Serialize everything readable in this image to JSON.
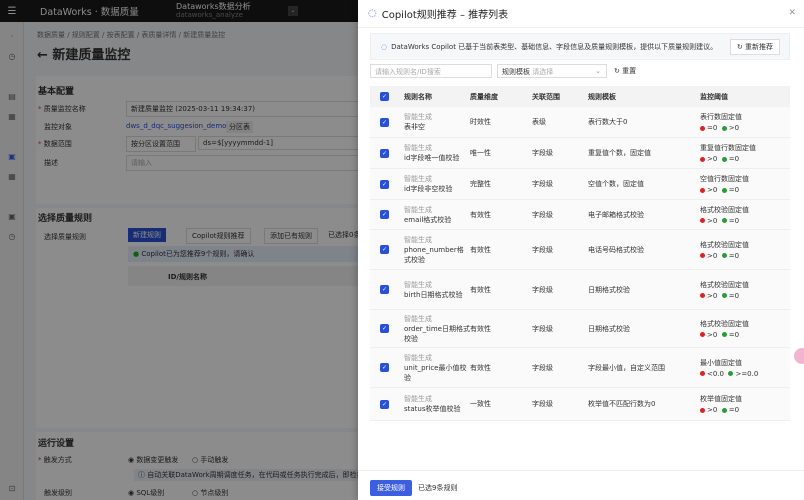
{
  "topbar": {
    "brand": "DataWorks · 数据质量",
    "workspace": "Dataworks数据分析",
    "workspace_id": "dataworks_analyze"
  },
  "page": {
    "breadcrumb": "数据质量 / 规则配置 / 按表配置 / 表质量详情 / 新建质量监控",
    "title": "新建质量监控",
    "basic": {
      "heading": "基本配置",
      "name_label": "质量监控名称",
      "name_value": "新建质量监控 (2025-03-11 19:34:37)",
      "object_label": "监控对象",
      "object_value": "dws_d_dqc_suggesion_demo",
      "object_tag": "分区表",
      "range_label": "数据范围",
      "range_select": "按分区设置范围",
      "range_value": "ds=$[yyyymmdd-1]",
      "desc_label": "描述",
      "desc_placeholder": "请输入"
    },
    "rules": {
      "heading": "选择质量规则",
      "label": "选择质量规则",
      "new_btn": "新建规则",
      "copilot_btn": "Copilot规则推荐",
      "add_btn": "添加已有规则",
      "selected": "已选择0条",
      "notice": "Copilot已为您推荐9个规则，请确认",
      "col": "ID/规则名称"
    },
    "run": {
      "heading": "运行设置",
      "trigger_label": "触发方式",
      "opt1": "数据变更触发",
      "opt2": "手动触发",
      "tip": "自动关联DataWork周期调度任务，在代码或任务执行完成后，即检指定",
      "level_label": "触发级别",
      "lvl1": "SQL级别",
      "lvl2": "节点级别"
    }
  },
  "panel": {
    "title": "Copilot规则推荐 – 推荐列表",
    "info": "DataWorks Copilot 已基于当前表类型、基础信息、字段信息及质量规则模板，提供以下质量规则建议。",
    "refresh": "重新推荐",
    "search_placeholder": "请输入规则名/ID搜索",
    "template_label": "规则模板",
    "template_placeholder": "请选择",
    "reset": "重置",
    "columns": [
      "规则名称",
      "质量维度",
      "关联范围",
      "规则模板",
      "监控阈值"
    ],
    "gen_label": "智能生成",
    "rows": [
      {
        "name": "表非空",
        "dim": "时效性",
        "scope": "表级",
        "tpl": "表行数大于0",
        "th": "表行数固定值",
        "red": "=0",
        "green": ">0"
      },
      {
        "name": "id字段唯一值校验",
        "dim": "唯一性",
        "scope": "字段级",
        "tpl": "重复值个数，固定值",
        "th": "重复值行数固定值",
        "red": ">0",
        "green": "=0"
      },
      {
        "name": "id字段非空校验",
        "dim": "完整性",
        "scope": "字段级",
        "tpl": "空值个数，固定值",
        "th": "空值行数固定值",
        "red": ">0",
        "green": "=0"
      },
      {
        "name": "email格式校验",
        "dim": "有效性",
        "scope": "字段级",
        "tpl": "电子邮箱格式校验",
        "th": "格式校验固定值",
        "red": ">0",
        "green": "=0"
      },
      {
        "name": "phone_number格式校验",
        "dim": "有效性",
        "scope": "字段级",
        "tpl": "电话号码格式校验",
        "th": "格式校验固定值",
        "red": ">0",
        "green": "=0"
      },
      {
        "name": "birth日期格式校验",
        "dim": "有效性",
        "scope": "字段级",
        "tpl": "日期格式校验",
        "th": "格式校验固定值",
        "red": ">0",
        "green": "=0"
      },
      {
        "name": "order_time日期格式校验",
        "dim": "有效性",
        "scope": "字段级",
        "tpl": "日期格式校验",
        "th": "格式校验固定值",
        "red": ">0",
        "green": "=0"
      },
      {
        "name": "unit_price最小值校验",
        "dim": "有效性",
        "scope": "字段级",
        "tpl": "字段最小值，自定义范围",
        "th": "最小值固定值",
        "red": "<0.0",
        "green": ">=0.0"
      },
      {
        "name": "status枚举值校验",
        "dim": "一致性",
        "scope": "字段级",
        "tpl": "枚举值不匹配行数为0",
        "th": "枚举值固定值",
        "red": ">0",
        "green": "=0"
      }
    ],
    "accept": "接受规则",
    "selected": "已选9条规则"
  }
}
